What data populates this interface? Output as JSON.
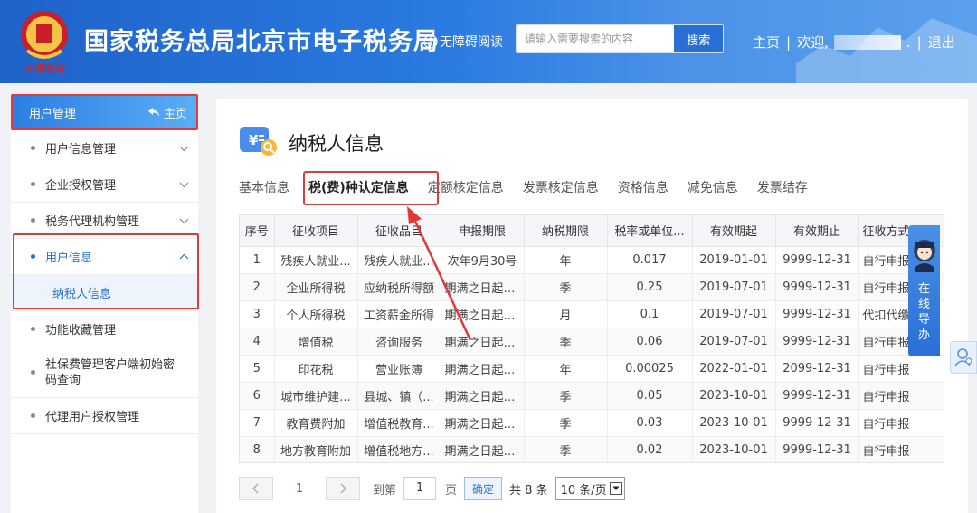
{
  "header": {
    "site_title": "国家税务总局北京市电子税务局",
    "accessibility_label": "无障碍阅读",
    "search_placeholder": "请输入需要搜索的内容",
    "search_button": "搜索",
    "nav_home": "主页",
    "nav_welcome": "欢迎,",
    "nav_logout": "退出",
    "separator": "|"
  },
  "sidebar": {
    "header_title": "用户管理",
    "header_home": "主页",
    "items": [
      {
        "label": "用户信息管理"
      },
      {
        "label": "企业授权管理"
      },
      {
        "label": "税务代理机构管理"
      },
      {
        "label": "用户信息"
      },
      {
        "label": "功能收藏管理"
      },
      {
        "label": "社保费管理客户端初始密码查询"
      },
      {
        "label": "代理用户授权管理"
      }
    ],
    "sub_item": "纳税人信息"
  },
  "main": {
    "page_title": "纳税人信息",
    "tabs": [
      {
        "label": "基本信息"
      },
      {
        "label": "税(费)种认定信息"
      },
      {
        "label": "定额核定信息"
      },
      {
        "label": "发票核定信息"
      },
      {
        "label": "资格信息"
      },
      {
        "label": "减免信息"
      },
      {
        "label": "发票结存"
      }
    ],
    "table": {
      "headers": [
        "序号",
        "征收项目",
        "征收品目",
        "申报期限",
        "纳税期限",
        "税率或单位...",
        "有效期起",
        "有效期止",
        "征收方式"
      ],
      "rows": [
        [
          "1",
          "残疾人就业...",
          "残疾人就业...",
          "次年9月30号",
          "年",
          "0.017",
          "2019-01-01",
          "9999-12-31",
          "自行申报"
        ],
        [
          "2",
          "企业所得税",
          "应纳税所得额",
          "期满之日起1...",
          "季",
          "0.25",
          "2019-07-01",
          "9999-12-31",
          "自行申报"
        ],
        [
          "3",
          "个人所得税",
          "工资薪金所得",
          "期满之日起1...",
          "月",
          "0.1",
          "2019-07-01",
          "9999-12-31",
          "代扣代缴"
        ],
        [
          "4",
          "增值税",
          "咨询服务",
          "期满之日起1...",
          "季",
          "0.06",
          "2019-07-01",
          "9999-12-31",
          "自行申报"
        ],
        [
          "5",
          "印花税",
          "营业账簿",
          "期满之日起1...",
          "年",
          "0.00025",
          "2022-01-01",
          "2099-12-31",
          "自行申报"
        ],
        [
          "6",
          "城市维护建...",
          "县城、镇（...",
          "期满之日起1...",
          "季",
          "0.05",
          "2023-10-01",
          "9999-12-31",
          "自行申报"
        ],
        [
          "7",
          "教育费附加",
          "增值税教育...",
          "期满之日起1...",
          "季",
          "0.03",
          "2023-10-01",
          "9999-12-31",
          "自行申报"
        ],
        [
          "8",
          "地方教育附加",
          "增值税地方...",
          "期满之日起1...",
          "季",
          "0.02",
          "2023-10-01",
          "9999-12-31",
          "自行申报"
        ]
      ]
    },
    "pager": {
      "current_page": "1",
      "goto_label": "到第",
      "goto_value": "1",
      "page_label": "页",
      "confirm": "确定",
      "total": "共 8 条",
      "page_size": "10 条/页"
    }
  },
  "float": {
    "online_text": "在线导办"
  },
  "colors": {
    "header_blue": "#2a7ae0",
    "accent": "#2a6fd6",
    "highlight_red": "#e03a3a"
  }
}
